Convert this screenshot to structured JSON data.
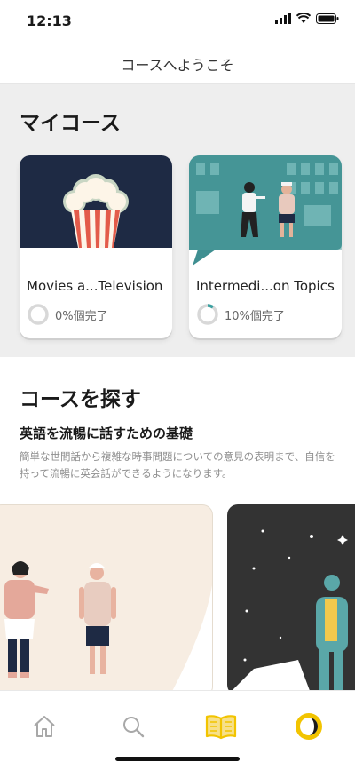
{
  "status": {
    "time": "12:13"
  },
  "header": {
    "title": "コースへようこそ"
  },
  "my_courses": {
    "title": "マイコース",
    "cards": [
      {
        "title": "Movies a...Television",
        "progress_text": "0%個完了",
        "progress": 0.0
      },
      {
        "title": "Intermedi...on Topics",
        "progress_text": "10%個完了",
        "progress": 0.1
      }
    ]
  },
  "explore": {
    "title": "コースを探す",
    "subtitle": "英語を流暢に話すための基礎",
    "description": "簡単な世間話から複雑な時事問題についての意見の表明まで、自信を持って流暢に英会話ができるようになります。"
  },
  "tabs": {
    "icons": [
      "home-icon",
      "search-icon",
      "book-icon",
      "profile-icon"
    ],
    "active_color": "#f2c400",
    "inactive_color": "#a8a8a8"
  },
  "colors": {
    "progress_track": "#d8d8d8",
    "progress_fill": "#3aa0a0",
    "accent": "#f2c400"
  }
}
